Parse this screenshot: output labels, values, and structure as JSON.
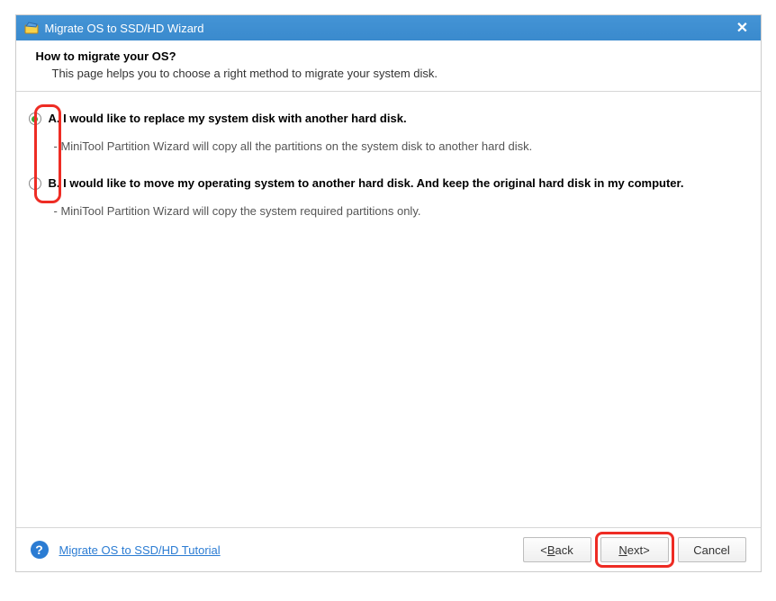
{
  "titlebar": {
    "title": "Migrate OS to SSD/HD Wizard"
  },
  "header": {
    "title": "How to migrate your OS?",
    "subtitle": "This page helps you to choose a right method to migrate your system disk."
  },
  "options": {
    "a": {
      "label": "A. I would like to replace my system disk with another hard disk.",
      "desc": "- MiniTool Partition Wizard will copy all the partitions on the system disk to another hard disk.",
      "selected": true
    },
    "b": {
      "label": "B. I would like to move my operating system to another hard disk. And keep the original hard disk in my computer.",
      "desc": "- MiniTool Partition Wizard will copy the system required partitions only.",
      "selected": false
    }
  },
  "footer": {
    "help_link": "Migrate OS to SSD/HD Tutorial",
    "back_label": "Back",
    "next_label": "Next",
    "cancel_label": "Cancel"
  }
}
